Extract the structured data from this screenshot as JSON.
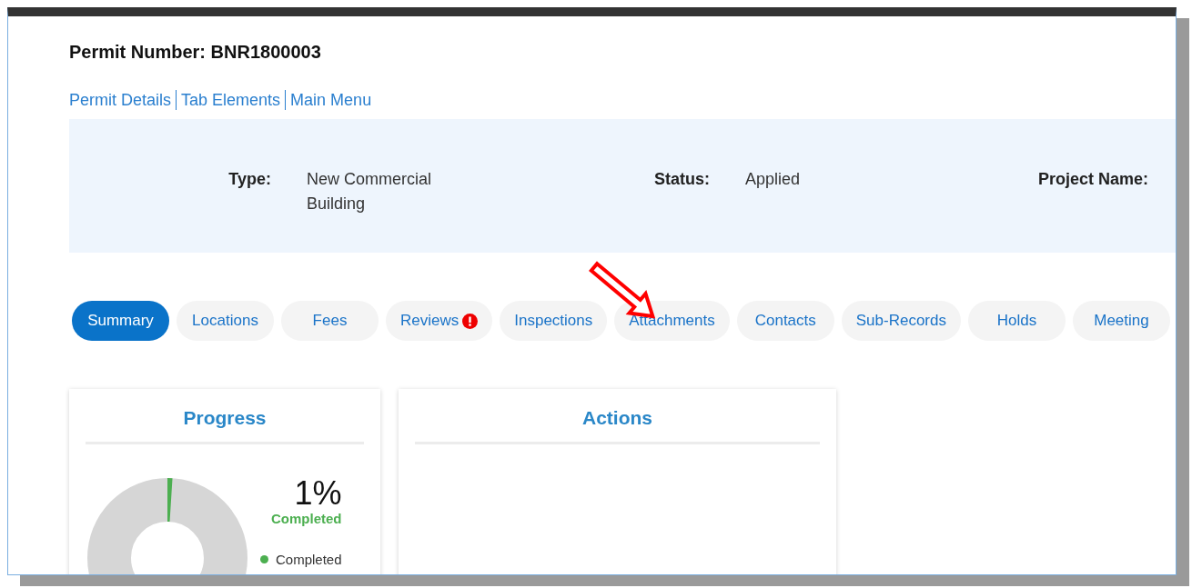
{
  "permit_title": "Permit Number: BNR1800003",
  "links": [
    "Permit Details",
    "Tab Elements",
    "Main Menu"
  ],
  "info": [
    {
      "label": "Type:",
      "value": "New Commercial Building"
    },
    {
      "label": "Status:",
      "value": "Applied"
    },
    {
      "label": "Project Name:"
    }
  ],
  "tabs": [
    {
      "label": "Summary",
      "selected": true
    },
    {
      "label": "Locations",
      "selected": false
    },
    {
      "label": "Fees",
      "selected": false
    },
    {
      "label": "Reviews",
      "selected": false,
      "alert": true
    },
    {
      "label": "Inspections",
      "selected": false
    },
    {
      "label": "Attachments",
      "selected": false
    },
    {
      "label": "Contacts",
      "selected": false
    },
    {
      "label": "Sub-Records",
      "selected": false
    },
    {
      "label": "Holds",
      "selected": false
    },
    {
      "label": "Meeting",
      "selected": false
    }
  ],
  "progress": {
    "title": "Progress",
    "percent": "1%",
    "caption": "Completed",
    "legend": [
      {
        "label": "Completed",
        "color": "#4caf50"
      }
    ]
  },
  "actions": {
    "title": "Actions"
  }
}
